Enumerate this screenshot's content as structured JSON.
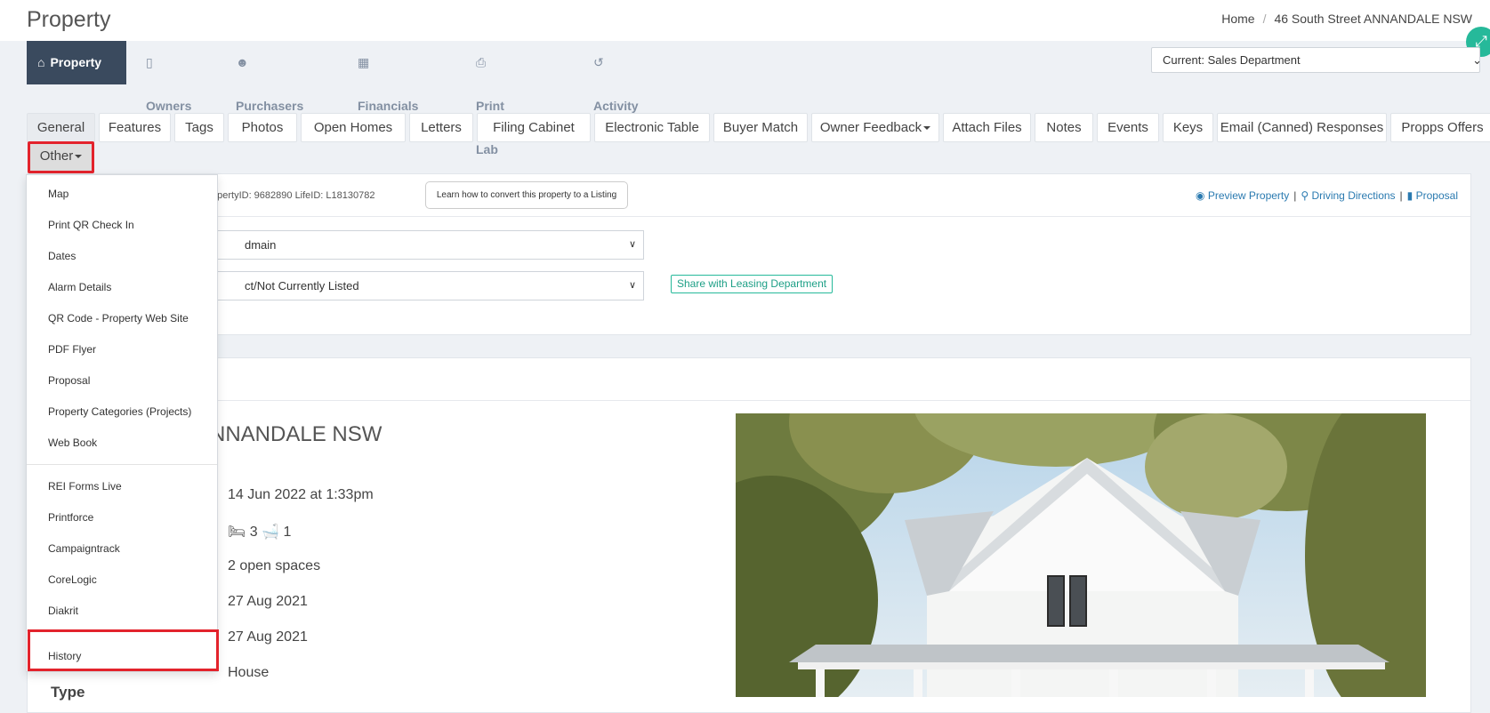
{
  "header": {
    "title": "Property",
    "breadcrumb": {
      "home": "Home",
      "separator": "/",
      "current": "46 South Street ANNANDALE NSW"
    }
  },
  "main_nav": [
    {
      "label": "Property",
      "icon": "home-icon"
    },
    {
      "label": "Owners",
      "icon": "file-icon"
    },
    {
      "label": "Purchasers",
      "icon": "users-icon"
    },
    {
      "label": "Financials",
      "icon": "calculator-icon"
    },
    {
      "label": "Print Lab",
      "icon": "print-icon"
    },
    {
      "label": "Activity",
      "icon": "history-icon"
    }
  ],
  "department": {
    "selected": "Current: Sales Department"
  },
  "tabs": [
    "General",
    "Features",
    "Tags",
    "Photos",
    "Open Homes",
    "Letters",
    "Filing Cabinet",
    "Electronic Table",
    "Buyer Match",
    "Owner Feedback",
    "Attach Files",
    "Notes",
    "Events",
    "Keys",
    "Email (Canned) Responses",
    "Propps Offers",
    "Other"
  ],
  "info": {
    "ids": "opertyID: 9682890 LifeID: L18130782",
    "learn_button": "Learn how to convert this property to a Listing",
    "links": {
      "preview": "Preview Property",
      "directions": "Driving Directions",
      "proposal": "Proposal"
    }
  },
  "form": {
    "select1": "dmain",
    "select2": "ct/Not Currently Listed",
    "share_button": "Share with Leasing Department"
  },
  "details": {
    "address": "NNANDALE NSW",
    "date_time": "14 Jun 2022 at 1:33pm",
    "bedrooms": "3",
    "bathrooms": "1",
    "parking": "2 open spaces",
    "date1": "27 Aug 2021",
    "date2": "27 Aug 2021",
    "type_label": "Type",
    "type_value": "House"
  },
  "dropdown": {
    "group1": [
      "Map",
      "Print QR Check In",
      "Dates",
      "Alarm Details",
      "QR Code - Property Web Site",
      "PDF Flyer",
      "Proposal",
      "Property Categories (Projects)",
      "Web Book"
    ],
    "group2": [
      "REI Forms Live",
      "Printforce",
      "Campaigntrack",
      "CoreLogic",
      "Diakrit"
    ],
    "group3": [
      "History"
    ]
  },
  "colors": {
    "accent": "#26b99a",
    "nav_active": "#3a4a5e",
    "highlight": "#e3232c",
    "link": "#2a7ab0"
  }
}
